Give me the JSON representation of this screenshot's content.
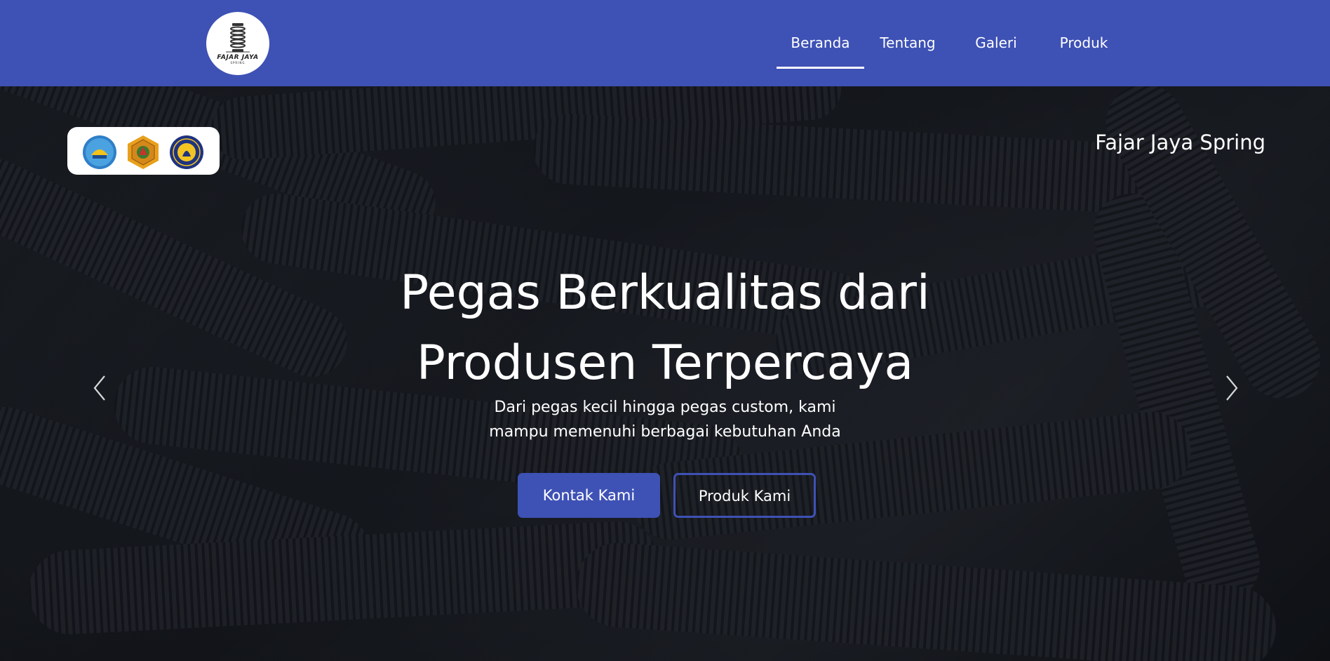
{
  "header": {
    "logo": {
      "name": "FAJAR JAYA",
      "sub": "SPRING"
    },
    "nav": [
      {
        "label": "Beranda",
        "active": true
      },
      {
        "label": "Tentang",
        "active": false
      },
      {
        "label": "Galeri",
        "active": false
      },
      {
        "label": "Produk",
        "active": false
      }
    ]
  },
  "hero": {
    "brand": "Fajar Jaya Spring",
    "headline_line1": "Pegas Berkualitas dari",
    "headline_line2": "Produsen Terpercaya",
    "subline_line1": "Dari pegas kecil hingga pegas custom, kami",
    "subline_line2": "mampu memenuhi berbagai kebutuhan Anda",
    "primary_button": "Kontak Kami",
    "secondary_button": "Produk Kami",
    "partner_logos": [
      "tut-wuri-handayani-logo",
      "university-seal-logo",
      "university-emblem-logo"
    ],
    "prev_icon": "chevron-left-icon",
    "next_icon": "chevron-right-icon"
  },
  "colors": {
    "primary": "#3e51b5",
    "text_light": "#ffffff",
    "hero_bg": "#22262e"
  }
}
